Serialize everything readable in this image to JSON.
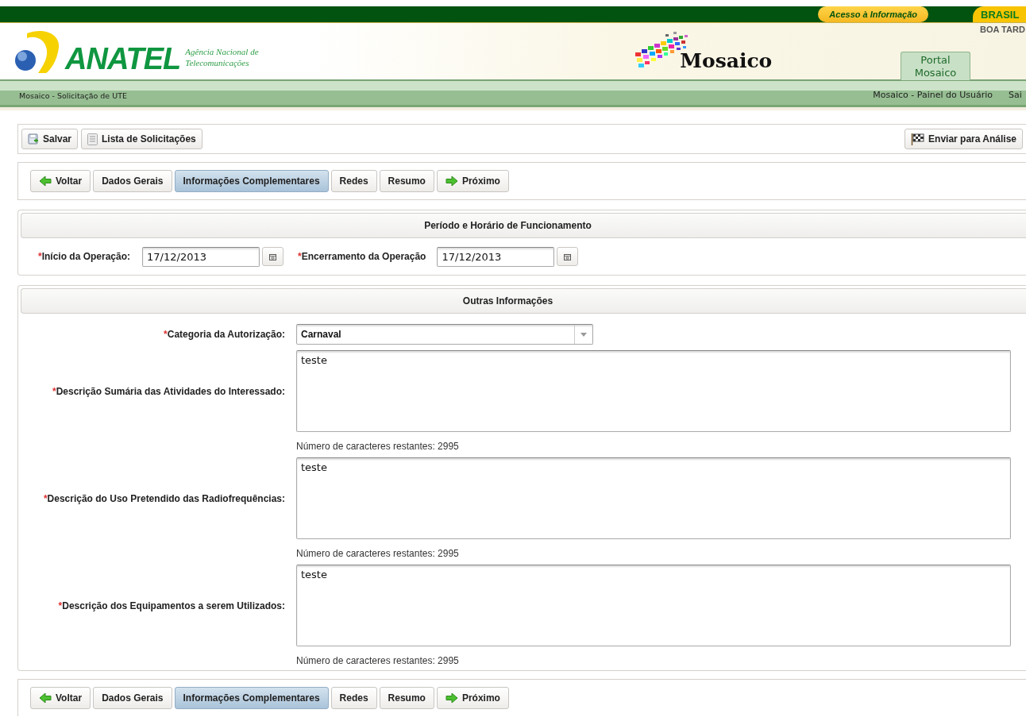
{
  "gov_bar": {
    "link": "Acesso à Informação",
    "brand": "BRASIL"
  },
  "header": {
    "logo_name": "ANATEL",
    "logo_tagline": "Agência Nacional de Telecomunicações",
    "app_name": "Mosaico",
    "greeting": "BOA TARD",
    "portal_tab": "Portal Mosaico"
  },
  "nav_bar": {
    "breadcrumb": "Mosaico - Solicitação de UTE",
    "links": [
      "Mosaico - Painel do Usuário",
      "Sai"
    ]
  },
  "toolbar": {
    "left": [
      {
        "label": "Salvar",
        "kind": "save"
      },
      {
        "label": "Lista de Solicitações",
        "kind": "list"
      }
    ],
    "right": [
      {
        "label": "Enviar para Análise",
        "kind": "submit"
      }
    ]
  },
  "steps_top": [
    {
      "label": "Voltar",
      "kind": "back",
      "selected": false
    },
    {
      "label": "Dados Gerais",
      "kind": "step",
      "selected": false
    },
    {
      "label": "Informações Complementares",
      "kind": "step",
      "selected": true
    },
    {
      "label": "Redes",
      "kind": "step",
      "selected": false
    },
    {
      "label": "Resumo",
      "kind": "step",
      "selected": false
    },
    {
      "label": "Próximo",
      "kind": "next",
      "selected": false
    }
  ],
  "period": {
    "title": "Período e Horário de Funcionamento",
    "fields": [
      {
        "label": "Início da Operação:",
        "required_mark": "*",
        "value": "17/12/2013"
      },
      {
        "label": "Encerramento da Operação",
        "required_mark": "*",
        "value": "17/12/2013"
      }
    ]
  },
  "other": {
    "title": "Outras Informações",
    "category": {
      "label": "Categoria da Autorização:",
      "required_mark": "*",
      "value": "Carnaval"
    },
    "descriptions": [
      {
        "label": "Descrição Sumária das Atividades do Interessado:",
        "required_mark": "*",
        "value": "teste",
        "counter": "Número de caracteres restantes: 2995"
      },
      {
        "label": "Descrição do Uso Pretendido das Radiofrequências:",
        "required_mark": "*",
        "value": "teste",
        "counter": "Número de caracteres restantes: 2995"
      },
      {
        "label": "Descrição dos Equipamentos a serem Utilizados:",
        "required_mark": "*",
        "value": "teste",
        "counter": "Número de caracteres restantes: 2995"
      }
    ]
  },
  "steps_bottom": [
    {
      "label": "Voltar",
      "kind": "back",
      "selected": false
    },
    {
      "label": "Dados Gerais",
      "kind": "step",
      "selected": false
    },
    {
      "label": "Informações Complementares",
      "kind": "step",
      "selected": true
    },
    {
      "label": "Redes",
      "kind": "step",
      "selected": false
    },
    {
      "label": "Resumo",
      "kind": "step",
      "selected": false
    },
    {
      "label": "Próximo",
      "kind": "next",
      "selected": false
    }
  ]
}
